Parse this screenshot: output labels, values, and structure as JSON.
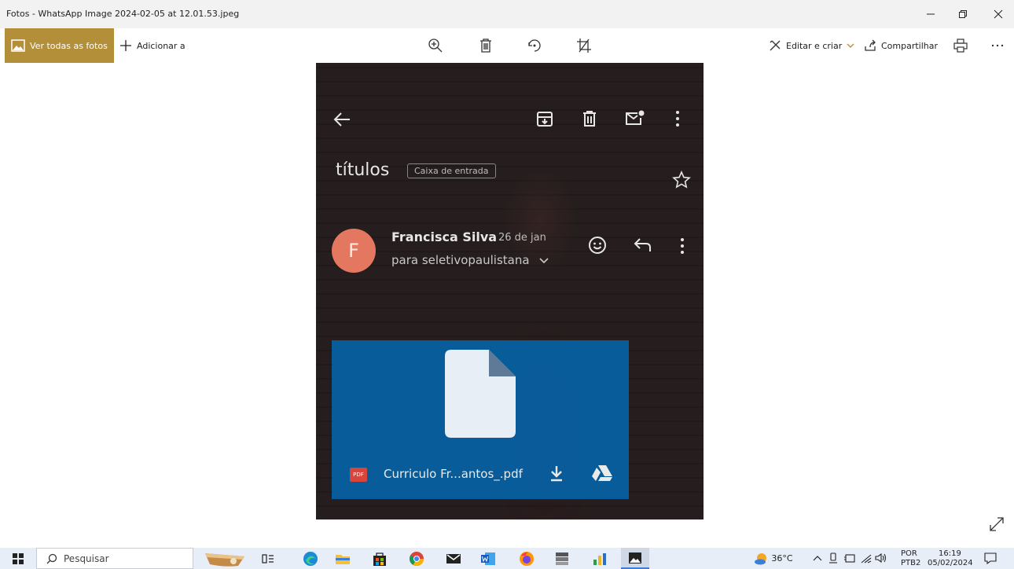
{
  "window": {
    "title": "Fotos - WhatsApp Image 2024-02-05 at 12.01.53.jpeg",
    "minimize_icon": "minimize-icon",
    "restore_icon": "restore-icon",
    "close_icon": "close-icon"
  },
  "toolbar": {
    "all_photos_label": "Ver todas as fotos",
    "add_to_label": "Adicionar a",
    "edit_create_label": "Editar e criar",
    "share_label": "Compartilhar",
    "icons": [
      "zoom-in-icon",
      "delete-icon",
      "rotate-icon",
      "crop-icon",
      "print-icon",
      "more-icon"
    ]
  },
  "photo": {
    "mail_folder_title": "títulos",
    "mail_label_badge": "Caixa de entrada",
    "sender_initial": "F",
    "sender_name": "Francisca Silva",
    "sent_date": "26 de jan",
    "recipient": "para seletivopaulistana",
    "attachment_type": "PDF",
    "attachment_name": "Curriculo Fr...antos_.pdf"
  },
  "taskbar": {
    "search_placeholder": "Pesquisar",
    "weather": "36°C",
    "language": "POR",
    "keyboard": "PTB2",
    "time": "16:19",
    "date": "05/02/2024"
  },
  "colors": {
    "accent": "#b48f3a",
    "avatar": "#e4775f",
    "attachment": "#006ebe",
    "taskbar": "#e8eef7"
  }
}
